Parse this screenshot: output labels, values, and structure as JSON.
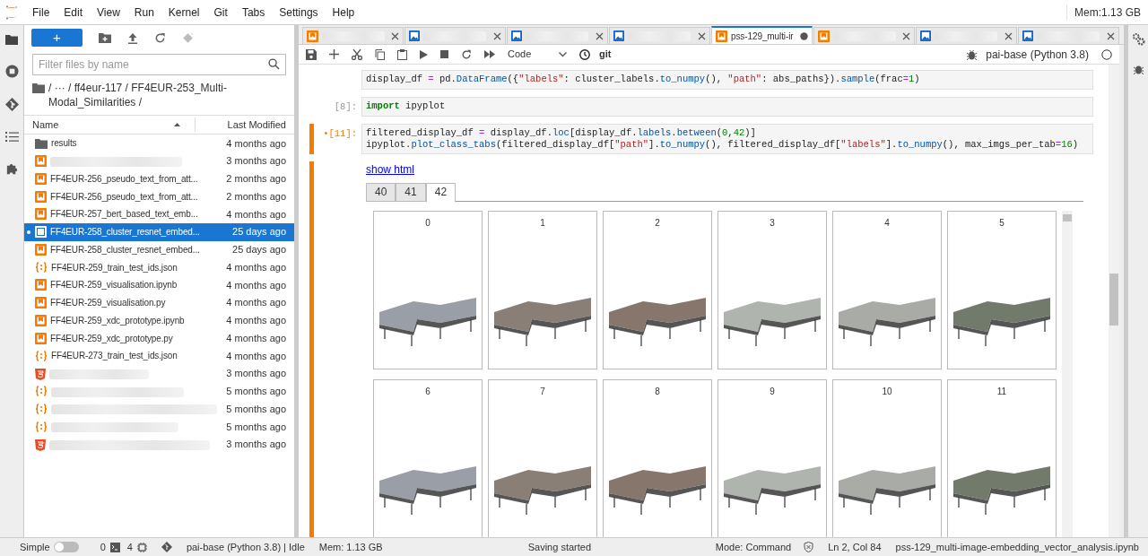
{
  "menu": {
    "items": [
      "File",
      "Edit",
      "View",
      "Run",
      "Kernel",
      "Git",
      "Tabs",
      "Settings",
      "Help"
    ],
    "memory": "Mem:1.13 GB"
  },
  "file_browser": {
    "new_button": "+",
    "filter": {
      "placeholder": "Filter files by name"
    },
    "breadcrumb": "/  ···  / ff4eur-117 / FF4EUR-253_Multi-Modal_Similarities /",
    "columns": [
      "Name",
      "Last Modified"
    ],
    "files": [
      {
        "kind": "folder",
        "name": "results",
        "modified": "4 months ago",
        "selected": false,
        "running": false
      },
      {
        "kind": "notebook",
        "modified": "3 months ago",
        "selected": false,
        "running": false
      },
      {
        "kind": "notebook",
        "name": "FF4EUR-256_pseudo_text_from_att...",
        "modified": "2 months ago",
        "selected": false,
        "running": false
      },
      {
        "kind": "notebook",
        "name": "FF4EUR-256_pseudo_text_from_att...",
        "modified": "2 months ago",
        "selected": false,
        "running": false
      },
      {
        "kind": "notebook",
        "name": "FF4EUR-257_bert_based_text_emb...",
        "modified": "4 months ago",
        "selected": false,
        "running": false
      },
      {
        "kind": "notebook",
        "name": "FF4EUR-258_cluster_resnet_embed...",
        "modified": "25 days ago",
        "selected": true,
        "running": true
      },
      {
        "kind": "notebook",
        "name": "FF4EUR-258_cluster_resnet_embed...",
        "modified": "25 days ago",
        "selected": false,
        "running": false
      },
      {
        "kind": "json",
        "name": "FF4EUR-259_train_test_ids.json",
        "modified": "4 months ago",
        "selected": false,
        "running": false
      },
      {
        "kind": "notebook",
        "name": "FF4EUR-259_visualisation.ipynb",
        "modified": "4 months ago",
        "selected": false,
        "running": false
      },
      {
        "kind": "notebook",
        "name": "FF4EUR-259_visualisation.py",
        "modified": "4 months ago",
        "selected": false,
        "running": false
      },
      {
        "kind": "notebook",
        "name": "FF4EUR-259_xdc_prototype.ipynb",
        "modified": "4 months ago",
        "selected": false,
        "running": false
      },
      {
        "kind": "notebook",
        "name": "FF4EUR-259_xdc_prototype.py",
        "modified": "4 months ago",
        "selected": false,
        "running": false
      },
      {
        "kind": "json",
        "name": "FF4EUR-273_train_test_ids.json",
        "modified": "4 months ago",
        "selected": false,
        "running": false
      },
      {
        "kind": "html",
        "modified": "3 months ago",
        "selected": false,
        "running": false
      },
      {
        "kind": "json",
        "modified": "5 months ago",
        "selected": false,
        "running": false
      },
      {
        "kind": "json",
        "modified": "5 months ago",
        "selected": false,
        "running": false
      },
      {
        "kind": "json",
        "modified": "5 months ago",
        "selected": false,
        "running": false
      },
      {
        "kind": "html",
        "modified": "3 months ago",
        "selected": false,
        "running": false
      }
    ]
  },
  "tabs": [
    {
      "kind": "notebook",
      "selected": false,
      "dirty": false
    },
    {
      "kind": "image",
      "selected": false,
      "dirty": false
    },
    {
      "kind": "image",
      "selected": false,
      "dirty": false
    },
    {
      "kind": "image",
      "selected": false,
      "dirty": false
    },
    {
      "kind": "notebook",
      "label": "pss-129_multi-ir",
      "selected": true,
      "dirty": true
    },
    {
      "kind": "notebook",
      "selected": false,
      "dirty": false
    },
    {
      "kind": "image",
      "selected": false,
      "dirty": false
    },
    {
      "kind": "image",
      "selected": false,
      "dirty": false
    }
  ],
  "toolbar": {
    "cell_type": "Code",
    "git": "git",
    "kernel": "pai-base (Python 3.8)"
  },
  "cells": [
    {
      "active": false,
      "lines": [
        [
          {
            "kind": "plain",
            "text": "display_df "
          },
          {
            "kind": "op",
            "text": "="
          },
          {
            "kind": "plain",
            "text": " pd."
          },
          {
            "kind": "func",
            "text": "DataFrame"
          },
          {
            "kind": "plain",
            "text": "({"
          },
          {
            "kind": "str",
            "text": "\"labels\""
          },
          {
            "kind": "plain",
            "text": ": cluster_labels."
          },
          {
            "kind": "func",
            "text": "to_numpy"
          },
          {
            "kind": "plain",
            "text": "(), "
          },
          {
            "kind": "str",
            "text": "\"path\""
          },
          {
            "kind": "plain",
            "text": ": abs_paths})."
          },
          {
            "kind": "func",
            "text": "sample"
          },
          {
            "kind": "plain",
            "text": "(frac"
          },
          {
            "kind": "op",
            "text": "="
          },
          {
            "kind": "num",
            "text": "1"
          },
          {
            "kind": "plain",
            "text": ")"
          }
        ]
      ]
    },
    {
      "active": false,
      "prompt": "[8]:",
      "lines": [
        [
          {
            "kind": "kw",
            "text": "import"
          },
          {
            "kind": "plain",
            "text": " ipyplot"
          }
        ]
      ]
    },
    {
      "active": true,
      "prompt": "•[11]:",
      "lines": [
        [
          {
            "kind": "plain",
            "text": "filtered_display_df "
          },
          {
            "kind": "op",
            "text": "="
          },
          {
            "kind": "plain",
            "text": " display_df."
          },
          {
            "kind": "func",
            "text": "loc"
          },
          {
            "kind": "plain",
            "text": "[display_df."
          },
          {
            "kind": "func",
            "text": "labels"
          },
          {
            "kind": "plain",
            "text": "."
          },
          {
            "kind": "func",
            "text": "between"
          },
          {
            "kind": "plain",
            "text": "("
          },
          {
            "kind": "num",
            "text": "0"
          },
          {
            "kind": "plain",
            "text": ","
          },
          {
            "kind": "num",
            "text": "42"
          },
          {
            "kind": "plain",
            "text": ")]"
          }
        ],
        [
          {
            "kind": "plain",
            "text": "ipyplot."
          },
          {
            "kind": "func",
            "text": "plot_class_tabs"
          },
          {
            "kind": "plain",
            "text": "(filtered_display_df["
          },
          {
            "kind": "str",
            "text": "\"path\""
          },
          {
            "kind": "plain",
            "text": "]."
          },
          {
            "kind": "func",
            "text": "to_numpy"
          },
          {
            "kind": "plain",
            "text": "(), filtered_display_df["
          },
          {
            "kind": "str",
            "text": "\"labels\""
          },
          {
            "kind": "plain",
            "text": "]."
          },
          {
            "kind": "func",
            "text": "to_numpy"
          },
          {
            "kind": "plain",
            "text": "(), max_imgs_per_tab"
          },
          {
            "kind": "op",
            "text": "="
          },
          {
            "kind": "num",
            "text": "16"
          },
          {
            "kind": "plain",
            "text": ")"
          }
        ]
      ],
      "output": {
        "link": "show html",
        "tabs": [
          {
            "label": "40",
            "selected": false
          },
          {
            "label": "41",
            "selected": false
          },
          {
            "label": "42",
            "selected": true
          }
        ],
        "images": [
          "0",
          "1",
          "2",
          "3",
          "4",
          "5",
          "6",
          "7",
          "8",
          "9",
          "10",
          "11"
        ]
      }
    }
  ],
  "status_bar": {
    "simple": {
      "label": "Simple",
      "on": false
    },
    "terminals": "0",
    "kernels": "4",
    "kernel_status": "pai-base (Python 3.8) | Idle",
    "memory": "Mem: 1.13 GB",
    "message": "Saving started",
    "mode": "Mode: Command",
    "position": "Ln 2, Col 84",
    "file": "pss-129_multi-image-embedding_vector_analysis.ipynb"
  }
}
